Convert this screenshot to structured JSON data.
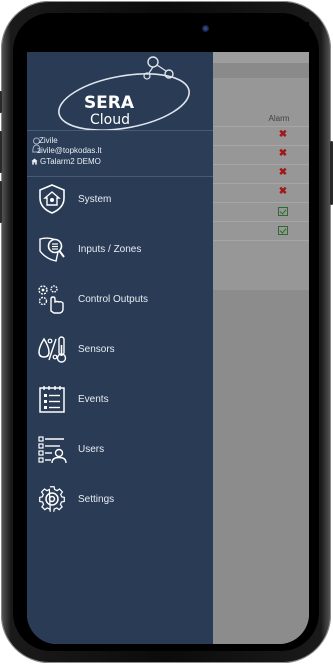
{
  "app": {
    "logo_text_top": "SERA",
    "logo_text_bottom": "Cloud"
  },
  "profile": {
    "name": "Zivile",
    "email": "zivile@topkodas.lt",
    "site": "GTalarm2 DEMO"
  },
  "menu": {
    "items": [
      {
        "label": "System",
        "icon": "shield-home-icon"
      },
      {
        "label": "Inputs / Zones",
        "icon": "zone-icon"
      },
      {
        "label": "Control Outputs",
        "icon": "control-outputs-icon"
      },
      {
        "label": "Sensors",
        "icon": "sensors-icon"
      },
      {
        "label": "Events",
        "icon": "events-list-icon"
      },
      {
        "label": "Users",
        "icon": "users-list-icon"
      },
      {
        "label": "Settings",
        "icon": "gear-icon"
      }
    ]
  },
  "background": {
    "column_header": "Alarm",
    "alarm_states": [
      "x",
      "x",
      "x",
      "x",
      "ok",
      "ok"
    ]
  },
  "colors": {
    "drawer": "#2a3b55",
    "overlay": "#8c8c8c",
    "alarm_x": "#a01818",
    "alarm_ok": "#2e6b2e"
  }
}
